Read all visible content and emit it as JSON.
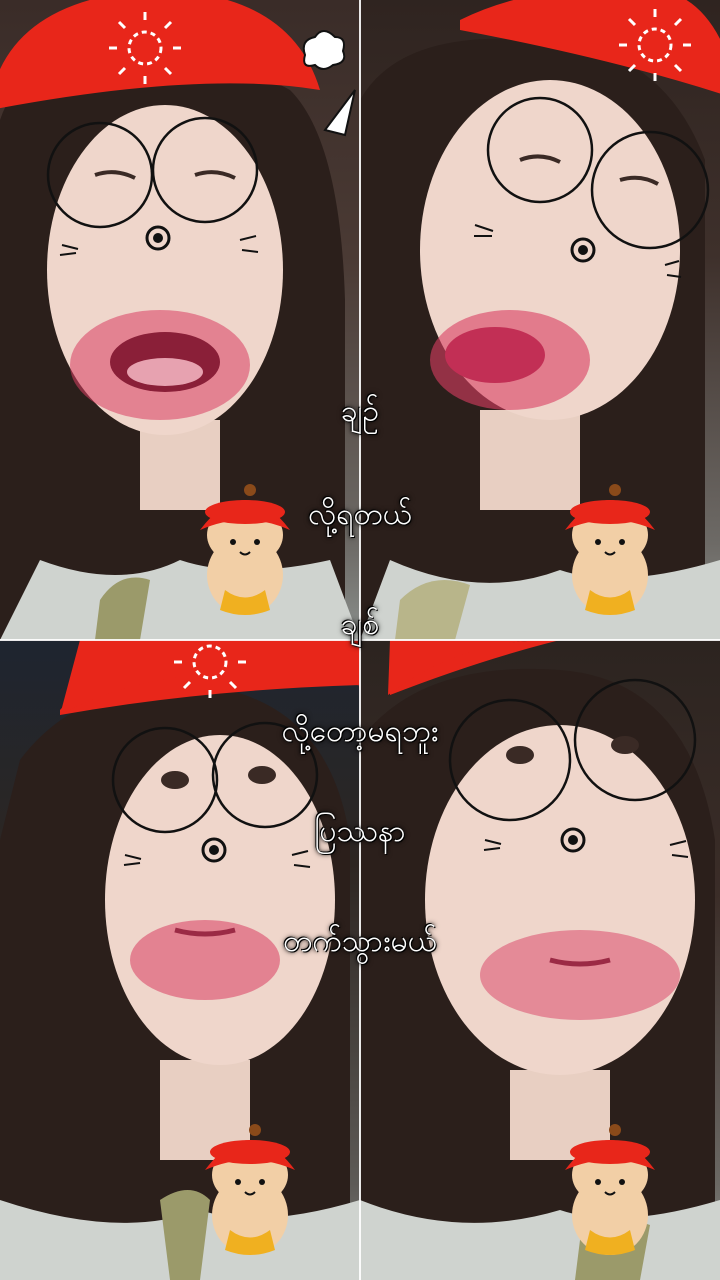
{
  "captions": {
    "line1": "ချဉ်",
    "line2": "လို့ရတယ်",
    "line3": "ချစ်",
    "line4": "လို့တော့မရဘူး",
    "line5": "ပြဿနာ",
    "line6": "တက်သွားမယ်"
  },
  "colors": {
    "hat": "#e8261a",
    "hair": "#2b1f1b",
    "skin": "#efd6cb",
    "lipstick": "#d93e63",
    "glasses": "#111111",
    "sticker_body": "#f2cfa6",
    "sticker_scarf": "#f0b020"
  },
  "panels": [
    {
      "id": "top-left",
      "expression": "mouth-open"
    },
    {
      "id": "top-right",
      "expression": "pout"
    },
    {
      "id": "bottom-left",
      "expression": "lips-pressed"
    },
    {
      "id": "bottom-right",
      "expression": "lips-pressed"
    }
  ],
  "icons": [
    "red-hat-icon",
    "round-glasses-icon",
    "nose-swirl-icon",
    "whiskers-icon",
    "hamster-sticker-icon",
    "sun-doodle-icon"
  ]
}
